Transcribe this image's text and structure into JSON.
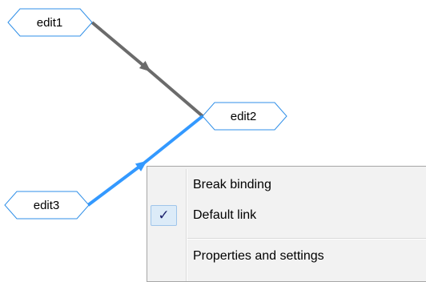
{
  "graph": {
    "nodes": [
      {
        "id": "edit1",
        "label": "edit1"
      },
      {
        "id": "edit2",
        "label": "edit2"
      },
      {
        "id": "edit3",
        "label": "edit3"
      }
    ],
    "links": [
      {
        "from": "edit1",
        "to": "edit2",
        "style": "default",
        "color": "#6b6b6b"
      },
      {
        "from": "edit3",
        "to": "edit2",
        "style": "selected",
        "color": "#3399ff"
      }
    ],
    "node_border_color": "#2f8fe8"
  },
  "context_menu": {
    "items": [
      {
        "label": "Break binding",
        "checked": false
      },
      {
        "label": "Default link",
        "checked": true
      },
      {
        "label": "Properties and settings",
        "checked": false
      }
    ],
    "check_glyph": "✓"
  }
}
